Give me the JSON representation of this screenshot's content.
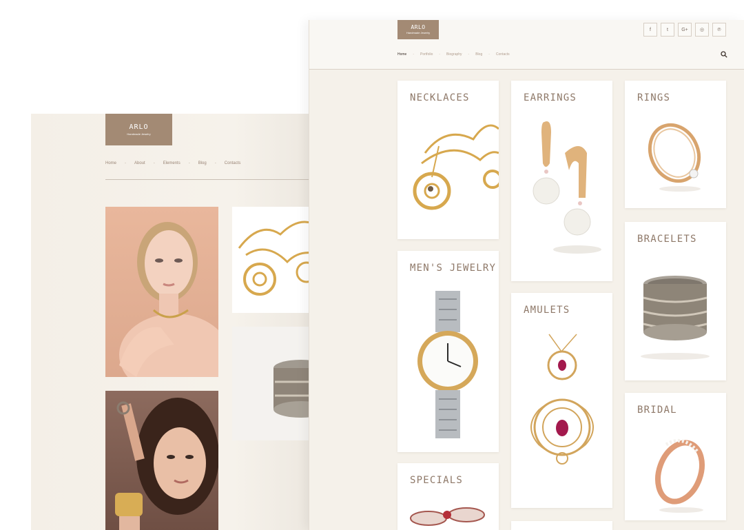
{
  "back_page": {
    "logo": {
      "title": "ARLO",
      "subtitle": "Handmade Jewelry"
    },
    "nav": [
      "Home",
      "About",
      "Elements",
      "Blog",
      "Contacts"
    ],
    "nav_separator": "-"
  },
  "front_page": {
    "logo": {
      "title": "ARLO",
      "subtitle": "Handmade Jewelry"
    },
    "nav": [
      "Home",
      "Portfolio",
      "Biography",
      "Blog",
      "Contacts"
    ],
    "nav_separator": "-",
    "socials": [
      {
        "icon": "facebook-icon",
        "glyph": "f"
      },
      {
        "icon": "twitter-icon",
        "glyph": "t"
      },
      {
        "icon": "google-plus-icon",
        "glyph": "G+"
      },
      {
        "icon": "instagram-icon",
        "glyph": "◎"
      },
      {
        "icon": "pinterest-icon",
        "glyph": "℗"
      }
    ],
    "categories": [
      "NECKLACES",
      "EARRINGS",
      "RINGS",
      "MEN'S JEWELRY",
      "BRACELETS",
      "AMULETS",
      "BRIDAL",
      "SPECIALS"
    ]
  },
  "colors": {
    "accent": "#a38a74",
    "title": "#8e7868",
    "page_bg": "#f5f1ea",
    "gold": "#d7a84e"
  }
}
